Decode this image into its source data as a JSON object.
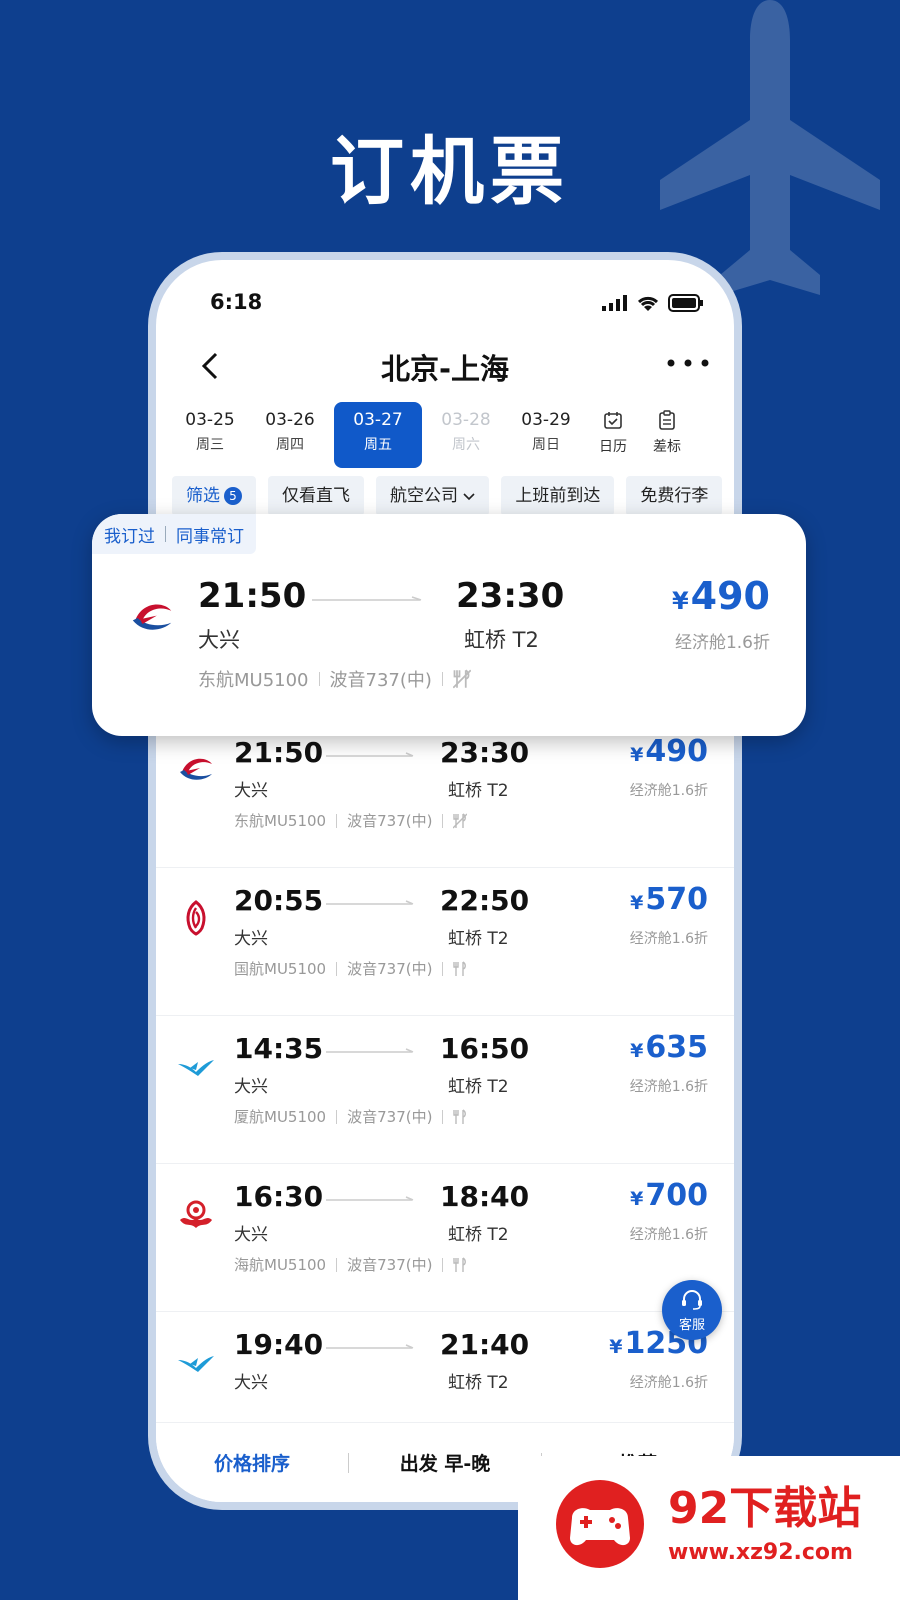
{
  "headline": "订机票",
  "status_bar": {
    "time": "6:18"
  },
  "nav": {
    "title": "北京-上海",
    "back_icon": "chevron-left-icon",
    "more_icon": "more-dots-icon"
  },
  "dates": [
    {
      "date": "03-25",
      "weekday": "周三",
      "state": "normal"
    },
    {
      "date": "03-26",
      "weekday": "周四",
      "state": "normal"
    },
    {
      "date": "03-27",
      "weekday": "周五",
      "state": "active"
    },
    {
      "date": "03-28",
      "weekday": "周六",
      "state": "disabled"
    },
    {
      "date": "03-29",
      "weekday": "周日",
      "state": "normal"
    }
  ],
  "date_tools": {
    "calendar": "日历",
    "price_marker": "差标"
  },
  "filters": {
    "filter_label": "筛选",
    "filter_count": "5",
    "direct_only": "仅看直飞",
    "airline": "航空公司",
    "before_work": "上班前到达",
    "free_luggage": "免费行李"
  },
  "popup": {
    "tag_booked": "我订过",
    "tag_colleague": "同事常订",
    "flight": {
      "dep_time": "21:50",
      "dep_airport": "大兴",
      "arr_time": "23:30",
      "arr_airport": "虹桥 T2",
      "flight_no": "东航MU5100",
      "aircraft": "波音737(中)",
      "price": "490",
      "cabin": "经济舱1.6折"
    }
  },
  "flights": [
    {
      "airline_icon": "china-eastern-logo-icon",
      "dep_time": "21:50",
      "dep_airport": "大兴",
      "arr_time": "23:30",
      "arr_airport": "虹桥 T2",
      "flight_no": "东航MU5100",
      "aircraft": "波音737(中)",
      "price": "490",
      "cabin": "经济舱1.6折"
    },
    {
      "airline_icon": "air-china-logo-icon",
      "dep_time": "20:55",
      "dep_airport": "大兴",
      "arr_time": "22:50",
      "arr_airport": "虹桥 T2",
      "flight_no": "国航MU5100",
      "aircraft": "波音737(中)",
      "price": "570",
      "cabin": "经济舱1.6折"
    },
    {
      "airline_icon": "xiamen-air-logo-icon",
      "dep_time": "14:35",
      "dep_airport": "大兴",
      "arr_time": "16:50",
      "arr_airport": "虹桥 T2",
      "flight_no": "厦航MU5100",
      "aircraft": "波音737(中)",
      "price": "635",
      "cabin": "经济舱1.6折"
    },
    {
      "airline_icon": "hainan-air-logo-icon",
      "dep_time": "16:30",
      "dep_airport": "大兴",
      "arr_time": "18:40",
      "arr_airport": "虹桥 T2",
      "flight_no": "海航MU5100",
      "aircraft": "波音737(中)",
      "price": "700",
      "cabin": "经济舱1.6折"
    },
    {
      "airline_icon": "xiamen-air-logo-icon",
      "dep_time": "19:40",
      "dep_airport": "大兴",
      "arr_time": "21:40",
      "arr_airport": "虹桥 T2",
      "flight_no": "",
      "aircraft": "",
      "price": "1250",
      "cabin": "经济舱1.6折"
    }
  ],
  "currency": "¥",
  "customer_service": "客服",
  "tabbar": {
    "price_sort": "价格排序",
    "depart_sort": "出发 早-晚",
    "recommend": "推荐"
  },
  "watermark": {
    "title": "92下载站",
    "url": "www.xz92.com"
  },
  "colors": {
    "background": "#0e3f8e",
    "accent": "#1a5fcc",
    "watermark": "#e02020"
  }
}
